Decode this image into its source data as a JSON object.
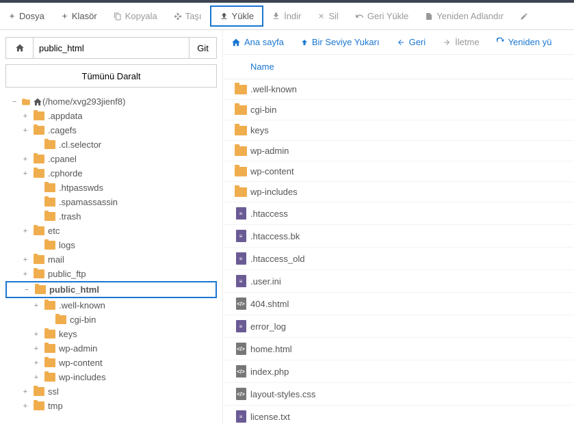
{
  "toolbar": [
    {
      "icon": "plus",
      "label": "Dosya",
      "disabled": false,
      "highlighted": false
    },
    {
      "icon": "plus",
      "label": "Klasör",
      "disabled": false,
      "highlighted": false
    },
    {
      "icon": "copy",
      "label": "Kopyala",
      "disabled": true,
      "highlighted": false
    },
    {
      "icon": "move",
      "label": "Taşı",
      "disabled": true,
      "highlighted": false
    },
    {
      "icon": "upload",
      "label": "Yükle",
      "disabled": false,
      "highlighted": true
    },
    {
      "icon": "download",
      "label": "İndir",
      "disabled": true,
      "highlighted": false
    },
    {
      "icon": "close",
      "label": "Sil",
      "disabled": true,
      "highlighted": false
    },
    {
      "icon": "undo",
      "label": "Geri Yükle",
      "disabled": true,
      "highlighted": false
    },
    {
      "icon": "rename",
      "label": "Yeniden Adlandır",
      "disabled": true,
      "highlighted": false
    },
    {
      "icon": "edit",
      "label": "",
      "disabled": true,
      "highlighted": false
    }
  ],
  "sidebar": {
    "path_value": "public_html",
    "go_label": "Git",
    "collapse_label": "Tümünü Daralt",
    "tree": [
      {
        "ind": 0,
        "toggle": "−",
        "type": "home",
        "label": "(/home/xvg293jienf8)",
        "selected": false
      },
      {
        "ind": 1,
        "toggle": "+",
        "type": "folder",
        "label": ".appdata",
        "selected": false
      },
      {
        "ind": 1,
        "toggle": "+",
        "type": "folder",
        "label": ".cagefs",
        "selected": false
      },
      {
        "ind": 2,
        "toggle": "",
        "type": "folder",
        "label": ".cl.selector",
        "selected": false
      },
      {
        "ind": 1,
        "toggle": "+",
        "type": "folder",
        "label": ".cpanel",
        "selected": false
      },
      {
        "ind": 1,
        "toggle": "+",
        "type": "folder",
        "label": ".cphorde",
        "selected": false
      },
      {
        "ind": 2,
        "toggle": "",
        "type": "folder",
        "label": ".htpasswds",
        "selected": false
      },
      {
        "ind": 2,
        "toggle": "",
        "type": "folder",
        "label": ".spamassassin",
        "selected": false
      },
      {
        "ind": 2,
        "toggle": "",
        "type": "folder",
        "label": ".trash",
        "selected": false
      },
      {
        "ind": 1,
        "toggle": "+",
        "type": "folder",
        "label": "etc",
        "selected": false
      },
      {
        "ind": 2,
        "toggle": "",
        "type": "folder",
        "label": "logs",
        "selected": false
      },
      {
        "ind": 1,
        "toggle": "+",
        "type": "folder",
        "label": "mail",
        "selected": false
      },
      {
        "ind": 1,
        "toggle": "+",
        "type": "folder",
        "label": "public_ftp",
        "selected": false
      },
      {
        "ind": 1,
        "toggle": "−",
        "type": "folder",
        "label": "public_html",
        "selected": true
      },
      {
        "ind": 2,
        "toggle": "+",
        "type": "folder",
        "label": ".well-known",
        "selected": false
      },
      {
        "ind": 3,
        "toggle": "",
        "type": "folder",
        "label": "cgi-bin",
        "selected": false
      },
      {
        "ind": 2,
        "toggle": "+",
        "type": "folder",
        "label": "keys",
        "selected": false
      },
      {
        "ind": 2,
        "toggle": "+",
        "type": "folder",
        "label": "wp-admin",
        "selected": false
      },
      {
        "ind": 2,
        "toggle": "+",
        "type": "folder",
        "label": "wp-content",
        "selected": false
      },
      {
        "ind": 2,
        "toggle": "+",
        "type": "folder",
        "label": "wp-includes",
        "selected": false
      },
      {
        "ind": 1,
        "toggle": "+",
        "type": "folder",
        "label": "ssl",
        "selected": false
      },
      {
        "ind": 1,
        "toggle": "+",
        "type": "folder",
        "label": "tmp",
        "selected": false
      }
    ]
  },
  "content": {
    "nav": [
      {
        "icon": "home",
        "label": "Ana sayfa",
        "disabled": false
      },
      {
        "icon": "up",
        "label": "Bir Seviye Yukarı",
        "disabled": false
      },
      {
        "icon": "back",
        "label": "Geri",
        "disabled": false
      },
      {
        "icon": "forward",
        "label": "İletme",
        "disabled": true
      },
      {
        "icon": "reload",
        "label": "Yeniden yü",
        "disabled": false
      }
    ],
    "header_name": "Name",
    "files": [
      {
        "type": "folder",
        "name": ".well-known"
      },
      {
        "type": "folder",
        "name": "cgi-bin"
      },
      {
        "type": "folder",
        "name": "keys"
      },
      {
        "type": "folder",
        "name": "wp-admin"
      },
      {
        "type": "folder",
        "name": "wp-content"
      },
      {
        "type": "folder",
        "name": "wp-includes"
      },
      {
        "type": "doc",
        "name": ".htaccess"
      },
      {
        "type": "doc",
        "name": ".htaccess.bk"
      },
      {
        "type": "doc",
        "name": ".htaccess_old"
      },
      {
        "type": "doc",
        "name": ".user.ini"
      },
      {
        "type": "code",
        "name": "404.shtml"
      },
      {
        "type": "doc",
        "name": "error_log"
      },
      {
        "type": "code",
        "name": "home.html"
      },
      {
        "type": "code",
        "name": "index.php"
      },
      {
        "type": "code",
        "name": "layout-styles.css"
      },
      {
        "type": "doc",
        "name": "license.txt"
      }
    ]
  }
}
